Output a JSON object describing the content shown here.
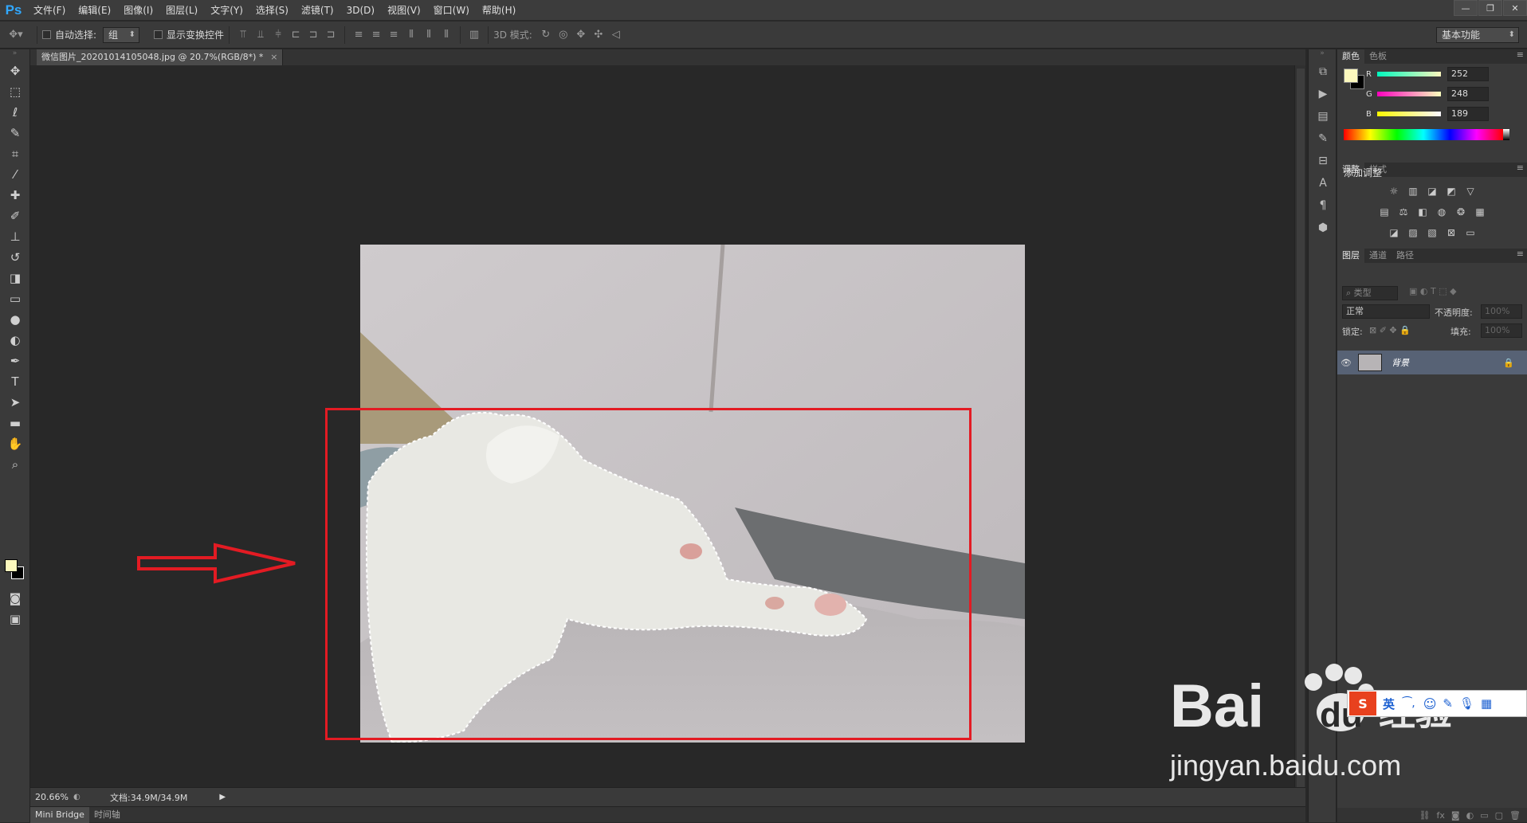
{
  "app": {
    "logo": "Ps"
  },
  "menu": [
    "文件(F)",
    "编辑(E)",
    "图像(I)",
    "图层(L)",
    "文字(Y)",
    "选择(S)",
    "滤镜(T)",
    "3D(D)",
    "视图(V)",
    "窗口(W)",
    "帮助(H)"
  ],
  "window_controls": {
    "minimize": "—",
    "restore": "❐",
    "close": "✕"
  },
  "options": {
    "auto_select_label": "自动选择:",
    "auto_select_value": "组",
    "show_transform_label": "显示变换控件",
    "mode_3d_label": "3D 模式:",
    "workspace": "基本功能"
  },
  "document": {
    "tab_title": "微信图片_20201014105048.jpg @ 20.7%(RGB/8*) *",
    "close": "×"
  },
  "status": {
    "zoom": "20.66%",
    "doc_size": "文档:34.9M/34.9M"
  },
  "bottom_tabs": [
    "Mini Bridge",
    "时间轴"
  ],
  "color_panel": {
    "tabs": [
      "颜色",
      "色板"
    ],
    "r_label": "R",
    "g_label": "G",
    "b_label": "B",
    "r": "252",
    "g": "248",
    "b": "189",
    "foreground": "#fcf8bd",
    "background": "#000000"
  },
  "adjust_panel": {
    "tabs": [
      "调整",
      "样式"
    ],
    "title": "添加调整"
  },
  "layers_panel": {
    "tabs": [
      "图层",
      "通道",
      "路径"
    ],
    "filter": "类型",
    "blend_mode": "正常",
    "opacity_label": "不透明度:",
    "opacity": "100%",
    "lock_label": "锁定:",
    "fill_label": "填充:",
    "fill": "100%",
    "layer_name": "背景"
  },
  "watermark": {
    "logo_text": "Bai",
    "logo_text2": "du",
    "cn": "经验",
    "url": "jingyan.baidu.com"
  },
  "ime": {
    "lang": "英"
  },
  "colors": {
    "selection_frame": "#e31b23",
    "accent_ps": "#31a8ff"
  }
}
